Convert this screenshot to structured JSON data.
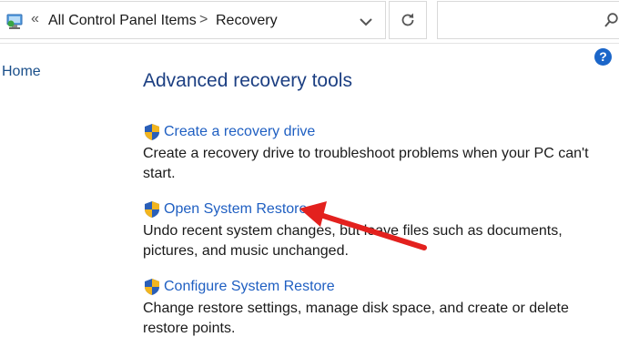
{
  "address": {
    "overflow_glyph": "«",
    "breadcrumbs": [
      "All Control Panel Items",
      "Recovery"
    ],
    "separator": ">",
    "refresh_glyph": "↻",
    "search_placeholder": "",
    "search_glyph": "⌕"
  },
  "nav": {
    "home_label": "Home"
  },
  "help": {
    "glyph": "?"
  },
  "main": {
    "title": "Advanced recovery tools",
    "tasks": [
      {
        "label": "Create a recovery drive",
        "description": "Create a recovery drive to troubleshoot problems when your PC can't start."
      },
      {
        "label": "Open System Restore",
        "description": "Undo recent system changes, but leave files such as documents, pictures, and music unchanged."
      },
      {
        "label": "Configure System Restore",
        "description": "Change restore settings, manage disk space, and create or delete restore points."
      }
    ]
  },
  "colors": {
    "link": "#1f5fc2",
    "title": "#1c3f82",
    "annotation_arrow": "#e3211e",
    "help_badge": "#1b66c9"
  },
  "icons": {
    "location": "control-panel-icon",
    "task": "uac-shield-icon",
    "dropdown": "chevron-down-icon",
    "refresh": "refresh-icon",
    "search": "search-icon",
    "help": "help-icon"
  }
}
